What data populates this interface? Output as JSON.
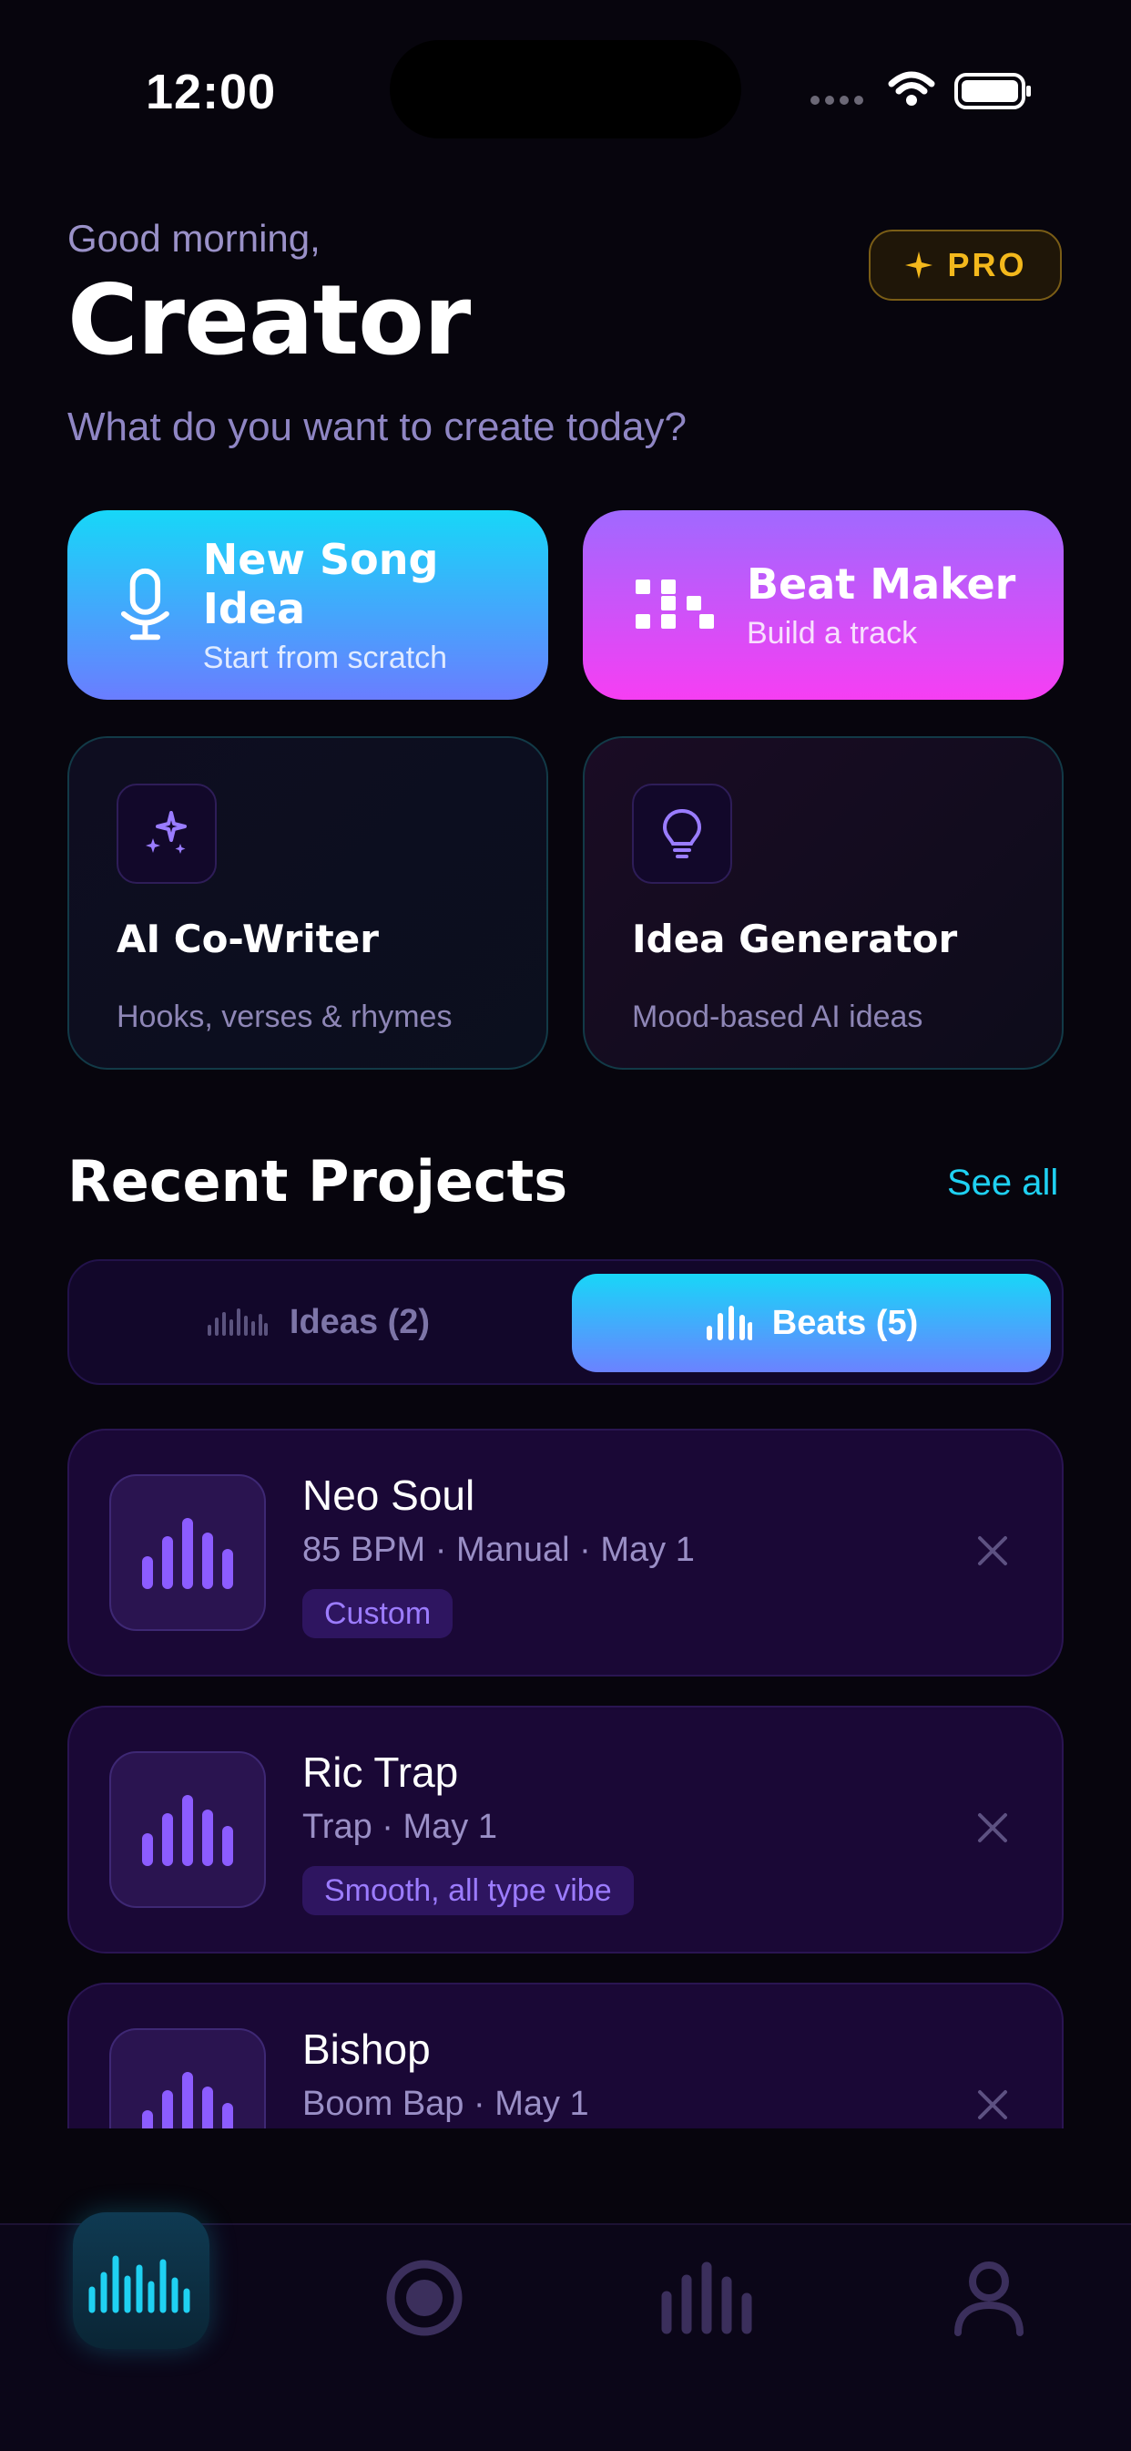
{
  "status": {
    "time": "12:00"
  },
  "header": {
    "greeting": "Good morning,",
    "name": "Creator",
    "prompt": "What do you want to create today?",
    "pro_label": "PRO"
  },
  "actions": [
    {
      "title": "New Song Idea",
      "subtitle": "Start from scratch",
      "icon": "microphone-icon"
    },
    {
      "title": "Beat Maker",
      "subtitle": "Build a track",
      "icon": "beat-grid-icon"
    }
  ],
  "tools": [
    {
      "title": "AI Co-Writer",
      "subtitle": "Hooks, verses & rhymes",
      "icon": "sparkles-icon"
    },
    {
      "title": "Idea Generator",
      "subtitle": "Mood-based AI ideas",
      "icon": "lightbulb-icon"
    }
  ],
  "recent": {
    "title": "Recent Projects",
    "see_all": "See all",
    "tabs": [
      {
        "label": "Ideas (2)",
        "active": false
      },
      {
        "label": "Beats (5)",
        "active": true
      }
    ],
    "items": [
      {
        "name": "Neo Soul",
        "meta": "85 BPM · Manual · May 1",
        "tag": "Custom"
      },
      {
        "name": "Ric Trap",
        "meta": "Trap · May 1",
        "tag": "Smooth, all type vibe"
      },
      {
        "name": "Bishop",
        "meta": "Boom Bap · May 1",
        "tag": ""
      }
    ]
  },
  "tabbar": [
    {
      "name": "home",
      "icon": "waveform-icon",
      "active": true
    },
    {
      "name": "record",
      "icon": "record-icon",
      "active": false
    },
    {
      "name": "beats",
      "icon": "bars-icon",
      "active": false
    },
    {
      "name": "profile",
      "icon": "user-icon",
      "active": false
    }
  ],
  "colors": {
    "background": "#07050d",
    "accent_cyan": "#1fd1f2",
    "accent_purple": "#9c7cff",
    "accent_pink": "#f63ef3",
    "pro_gold": "#f3b81c"
  }
}
